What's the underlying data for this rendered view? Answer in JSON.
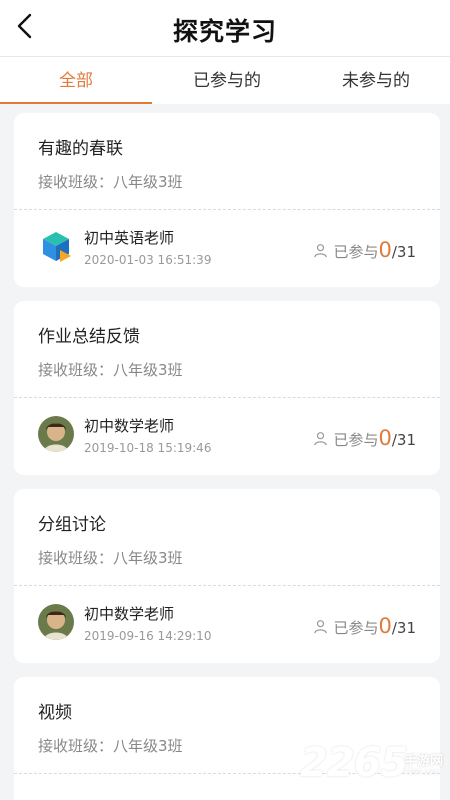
{
  "header": {
    "title": "探究学习"
  },
  "tabs": [
    {
      "label": "全部"
    },
    {
      "label": "已参与的"
    },
    {
      "label": "未参与的"
    }
  ],
  "cards": [
    {
      "title": "有趣的春联",
      "class_label": "接收班级：八年级3班",
      "teacher": "初中英语老师",
      "time": "2020-01-03 16:51:39",
      "participated_label": "已参与",
      "count": "0",
      "total": "/31",
      "avatar": "cube-logo"
    },
    {
      "title": "作业总结反馈",
      "class_label": "接收班级：八年级3班",
      "teacher": "初中数学老师",
      "time": "2019-10-18 15:19:46",
      "participated_label": "已参与",
      "count": "0",
      "total": "/31",
      "avatar": "teacher-photo"
    },
    {
      "title": "分组讨论",
      "class_label": "接收班级：八年级3班",
      "teacher": "初中数学老师",
      "time": "2019-09-16 14:29:10",
      "participated_label": "已参与",
      "count": "0",
      "total": "/31",
      "avatar": "teacher-photo"
    },
    {
      "title": "视频",
      "class_label": "接收班级：八年级3班"
    }
  ],
  "watermark": {
    "number": "2265",
    "text": "手游网",
    "url": "2265.com"
  },
  "colors": {
    "accent": "#e07b3b",
    "background": "#f3f4f6"
  }
}
